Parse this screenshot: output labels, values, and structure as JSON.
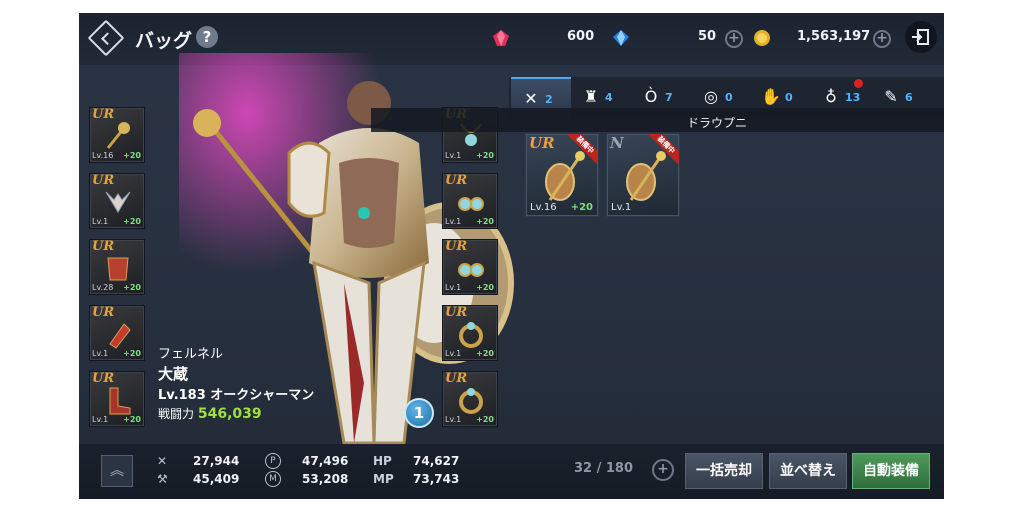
{
  "header": {
    "title": "バッグ",
    "help": "?"
  },
  "currency": {
    "red_gem": "600",
    "blue_gem": "50",
    "gold": "1,563,197"
  },
  "tabs": [
    {
      "icon": "sword-cross-icon",
      "count": "2",
      "active": true
    },
    {
      "icon": "armor-icon",
      "count": "4"
    },
    {
      "icon": "necklace-icon",
      "count": "7"
    },
    {
      "icon": "ring-icon",
      "count": "0"
    },
    {
      "icon": "glove-icon",
      "count": "0"
    },
    {
      "icon": "potion-icon",
      "count": "13"
    },
    {
      "icon": "scroll-icon",
      "count": "6"
    }
  ],
  "tooltip": "ドラウプニ",
  "equipped_left": [
    {
      "grade": "UR",
      "level": "Lv.16",
      "enhance": "+20"
    },
    {
      "grade": "UR",
      "level": "Lv.1",
      "enhance": "+20"
    },
    {
      "grade": "UR",
      "level": "Lv.28",
      "enhance": "+20"
    },
    {
      "grade": "UR",
      "level": "Lv.1",
      "enhance": "+20"
    },
    {
      "grade": "UR",
      "level": "Lv.1",
      "enhance": "+20"
    }
  ],
  "equipped_right": [
    {
      "grade": "UR",
      "level": "Lv.1",
      "enhance": "+20"
    },
    {
      "grade": "UR",
      "level": "Lv.1",
      "enhance": "+20"
    },
    {
      "grade": "UR",
      "level": "Lv.1",
      "enhance": "+20"
    },
    {
      "grade": "UR",
      "level": "Lv.1",
      "enhance": "+20"
    },
    {
      "grade": "UR",
      "level": "Lv.1",
      "enhance": "+20"
    }
  ],
  "bag_items": [
    {
      "grade": "UR",
      "level": "Lv.16",
      "enhance": "+20",
      "tag": "装備中"
    },
    {
      "grade": "N",
      "level": "Lv.1",
      "enhance": "",
      "tag": "装備中"
    }
  ],
  "character": {
    "guild": "フェルネル",
    "name": "大蔵",
    "level_class": "Lv.183 オークシャーマン",
    "power_label": "戦闘力",
    "power": "546,039"
  },
  "badge": "1",
  "stats": {
    "atk": "27,944",
    "def": "45,409",
    "p": "47,496",
    "m": "53,208",
    "hp_label": "HP",
    "hp": "74,627",
    "mp_label": "MP",
    "mp": "73,743"
  },
  "capacity": "32 / 180",
  "buttons": {
    "sell": "一括売却",
    "sort": "並べ替え",
    "auto": "自動装備"
  }
}
